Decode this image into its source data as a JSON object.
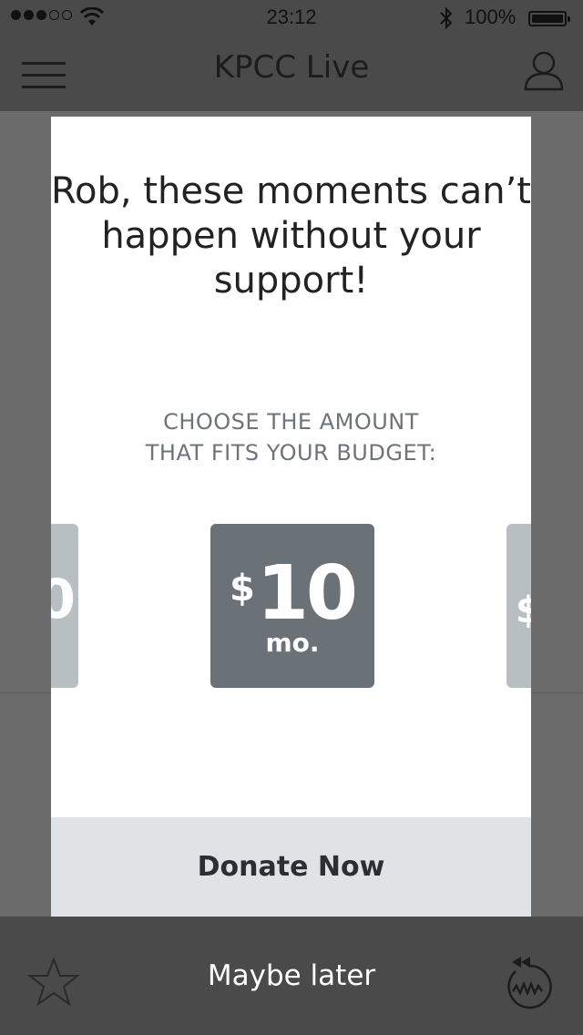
{
  "status_bar": {
    "signal_dots_filled": 3,
    "signal_dots_total": 5,
    "time": "23:12",
    "battery_percent": "100%"
  },
  "nav": {
    "title": "KPCC Live",
    "menu_icon": "hamburger-menu-icon",
    "account_icon": "user-icon"
  },
  "modal": {
    "headline": "Rob, these moments can’t happen without your support!",
    "subhead_line1": "CHOOSE THE AMOUNT",
    "subhead_line2": "THAT FITS YOUR BUDGET:",
    "amounts": {
      "left": {
        "currency": "",
        "value": "0"
      },
      "selected": {
        "currency": "$",
        "value": "10",
        "period": "mo."
      },
      "right": {
        "currency": "$",
        "value": ""
      }
    },
    "donate_label": "Donate Now"
  },
  "footer": {
    "maybe_later": "Maybe later",
    "star_icon": "star-icon",
    "rewind_icon": "rewind-live-icon"
  },
  "colors": {
    "overlay": "#6b6b6b",
    "bars": "#4a4a4a",
    "card_selected": "#6b7277",
    "card_adjacent": "#b8bfc3",
    "donate_bg": "#dfe3e6"
  }
}
